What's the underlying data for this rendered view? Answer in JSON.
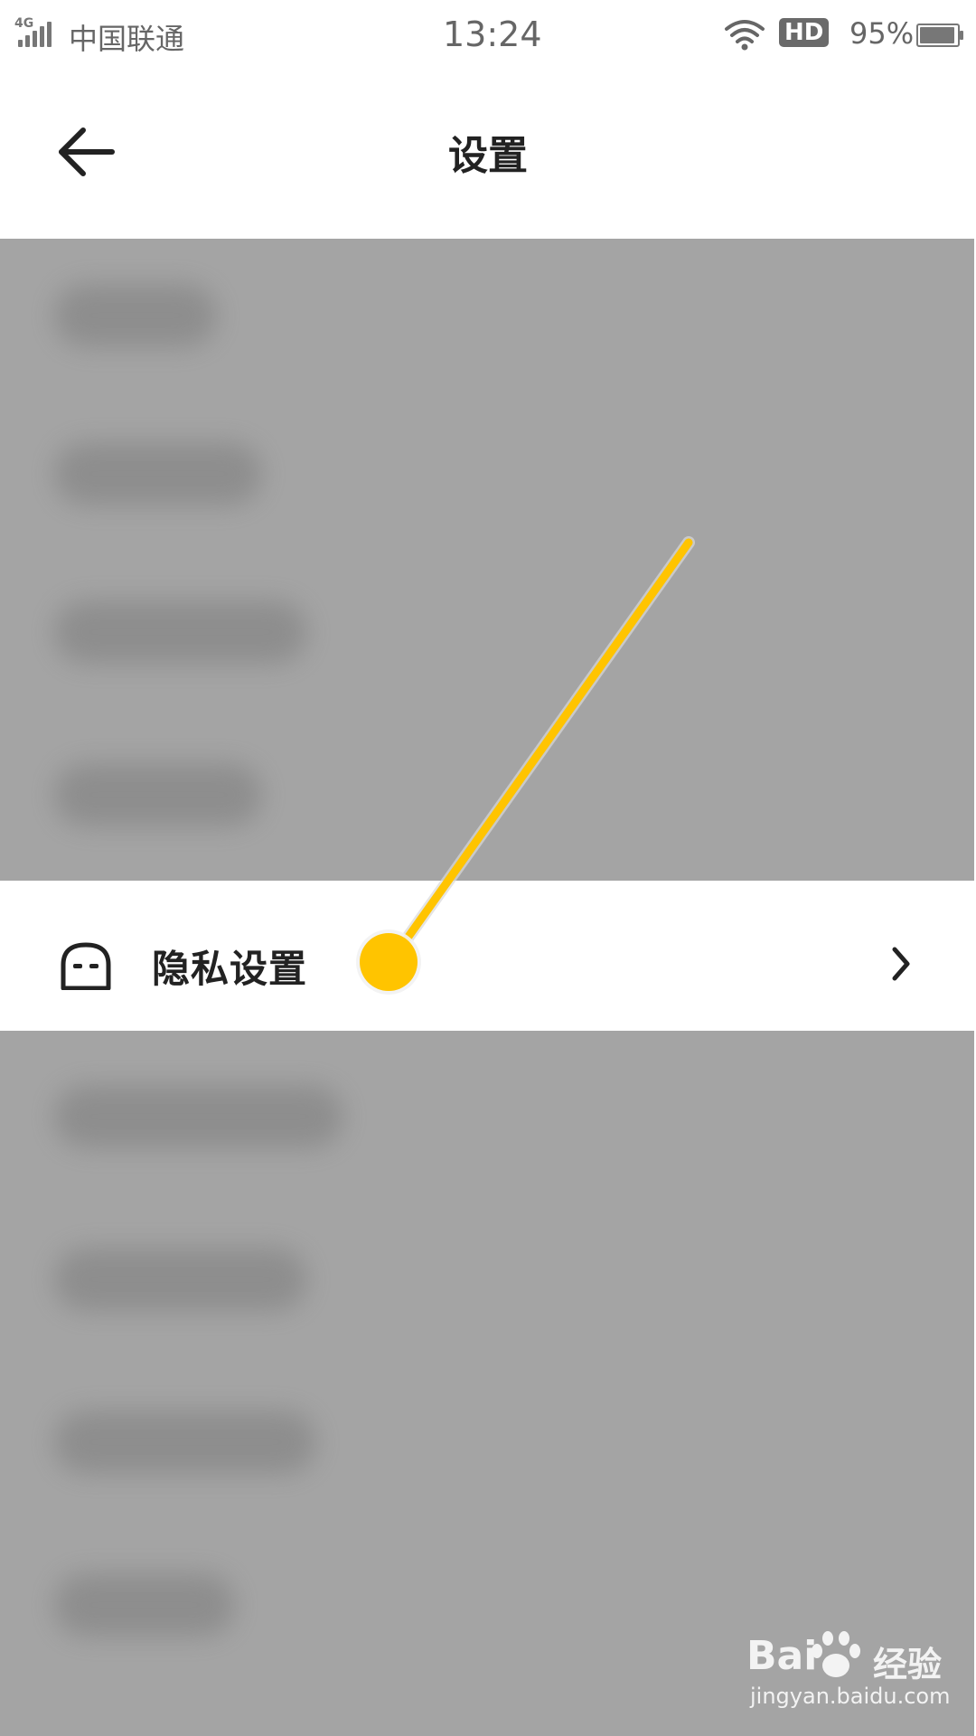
{
  "status_bar": {
    "network_type": "4G",
    "carrier": "中国联通",
    "time": "13:24",
    "hd_badge": "HD",
    "battery_percent": "95%",
    "battery_level": 0.95
  },
  "header": {
    "title": "设置",
    "back_icon": "arrow-left-icon"
  },
  "privacy_row": {
    "label": "隐私设置",
    "icon": "ghost-face-icon",
    "chevron_icon": "chevron-right-icon"
  },
  "annotation": {
    "color": "#FFC400"
  },
  "watermark": {
    "brand": "Bai",
    "product": "经验",
    "url": "jingyan.baidu.com"
  },
  "colors": {
    "overlay": "#A4A4A4",
    "highlight_row": "#FFFFFF",
    "text": "#222222",
    "status_text": "#666666",
    "accent": "#FFC400"
  }
}
